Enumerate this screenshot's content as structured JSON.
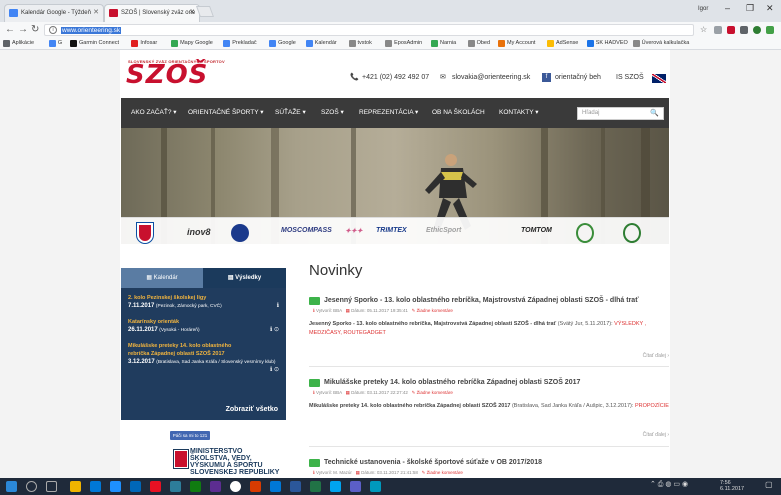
{
  "browser": {
    "tabs": [
      {
        "title": "Kalendár Google - Týždeň",
        "favicon_color": "#4285f4"
      },
      {
        "title": "SZOŠ | Slovenský zväz orie",
        "favicon_color": "#c8102e"
      }
    ],
    "window_user": "Igor",
    "url": "www.orienteering.sk",
    "bookmarks": [
      {
        "label": "Aplikácie",
        "color": "#5f6368"
      },
      {
        "label": "G",
        "color": "#4285f4"
      },
      {
        "label": "Garmin Connect",
        "color": "#111111"
      },
      {
        "label": "Infosar",
        "color": "#e02020"
      },
      {
        "label": "Mapy Google",
        "color": "#34a853"
      },
      {
        "label": "Prekladač",
        "color": "#4285f4"
      },
      {
        "label": "Google",
        "color": "#4285f4"
      },
      {
        "label": "Kalendár",
        "color": "#4285f4"
      },
      {
        "label": "tvstok",
        "color": "#888888"
      },
      {
        "label": "EposAdmin",
        "color": "#888888"
      },
      {
        "label": "Narnia",
        "color": "#34a853"
      },
      {
        "label": "Obed",
        "color": "#888888"
      },
      {
        "label": "My Account",
        "color": "#e8710a"
      },
      {
        "label": "AdSense",
        "color": "#fbbc04"
      },
      {
        "label": "SK HADVEO",
        "color": "#1a73e8"
      },
      {
        "label": "Úverová kalkulačka",
        "color": "#888888"
      }
    ]
  },
  "site": {
    "logo_small": "SLOVENSKÝ ZVÄZ ORIENTAČNÝCH ŠPORTOV",
    "logo": "SZOŠ",
    "phone": "+421 (02) 492 492 07",
    "email": "slovakia@orienteering.sk",
    "facebook": "orientačný beh",
    "is_link": "IS SZOŠ",
    "nav": [
      "AKO ZAČAŤ? ▾",
      "ORIENTAČNÉ ŠPORTY ▾",
      "SÚŤAŽE ▾",
      "SZOŠ ▾",
      "REPREZENTÁCIA ▾",
      "OB NA ŠKOLÁCH",
      "KONTAKTY ▾"
    ],
    "search_placeholder": "Hľadaj",
    "sponsors": [
      "inov8",
      "MOSCOMPASS",
      "TRIMTEX",
      "EthicSport",
      "TOMTOM"
    ],
    "sidebar": {
      "tab_calendar": "Kalendár",
      "tab_results": "Výsledky",
      "events": [
        {
          "title": "2. kolo Pezinskej školskej ligy",
          "date": "7.11.2017",
          "place": "(Pezinok, Zámocký park, CVČ)",
          "icons": "ℹ"
        },
        {
          "title": "Katarínsky orienták",
          "date": "26.11.2017",
          "place": "(Vysoká - Horáreň)",
          "icons": "ℹ ⊙"
        },
        {
          "title": "Mikulášske preteky 14. kolo oblastného rebríčka Západnej oblasti SZOŠ 2017",
          "date": "3.12.2017",
          "place": "(Bratislava, Sad Janka Kráľa / Slovenský vesmírny klub)",
          "icons": "ℹ ⊙"
        }
      ],
      "show_all": "Zobraziť všetko",
      "fb_like": "Páči sa mi to 121",
      "ministry": [
        "MINISTERSTVO",
        "ŠKOLSTVA, VEDY,",
        "VÝSKUMU A ŠPORTU",
        "SLOVENSKEJ REPUBLIKY"
      ]
    },
    "main_title": "Novinky",
    "articles": [
      {
        "title": "Jesenný Sporko - 13. kolo oblastného rebríčka, Majstrovstvá Západnej oblasti SZOŠ - dlhá trať",
        "author": "Vytvoril: BBA",
        "date": "Dátum: 05.11.2017 19:35:41",
        "comments": "Žiadne komentáre",
        "body_bold": "Jesenný Sporko - 13. kolo oblastného rebríčka, Majstrovstvá Západnej oblasti SZOŠ - dlhá trať",
        "body_rest": "(Svätý Jur, 5.11.2017):",
        "body_links": "VÝSLEDKY , MEDZIČASY, ROUTEGADGET",
        "more": "Čítať ďalej ›"
      },
      {
        "title": "Mikulášske preteky 14. kolo oblastného rebríčka Západnej oblasti SZOŠ 2017",
        "author": "Vytvoril: BBA",
        "date": "Dátum: 03.11.2017 22:27:42",
        "comments": "Žiadne komentáre",
        "body_bold": "Mikulášske preteky 14. kolo oblastného rebríčka Západnej oblasti SZOŠ 2017",
        "body_rest": "(Bratislava, Sad Janka Kráľa / Aušpic, 3.12.2017):",
        "body_links": "PROPOZÍCIE",
        "more": "Čítať ďalej ›"
      },
      {
        "title": "Technické ustanovenia - školské športové súťaže v OB 2017/2018",
        "author": "Vytvoril: M. Mazúr",
        "date": "Dátum: 03.11.2017 21:41:58",
        "comments": "Žiadne komentáre"
      }
    ]
  },
  "taskbar": {
    "time": "7:56",
    "date": "6.11.2017"
  }
}
